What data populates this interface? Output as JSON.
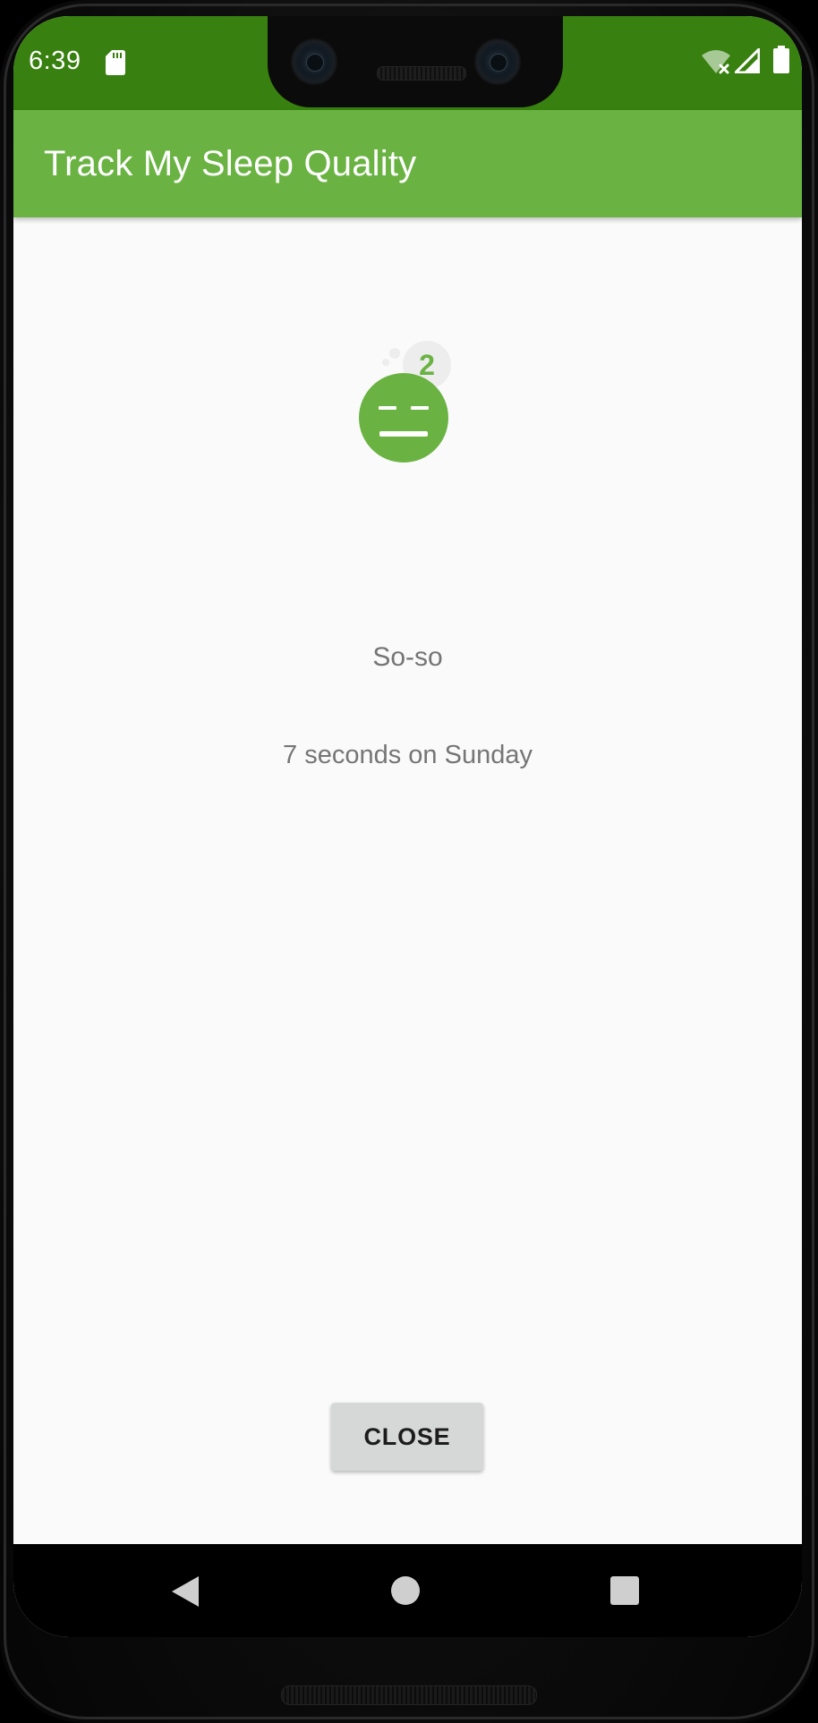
{
  "status_bar": {
    "time": "6:39",
    "icons": [
      "sd-card-icon",
      "wifi-off-icon",
      "signal-icon",
      "battery-icon"
    ]
  },
  "app_bar": {
    "title": "Track My Sleep Quality"
  },
  "sleep_detail": {
    "quality_icon": "sleep-quality-2-icon",
    "quality_number": "2",
    "quality_text": "So-so",
    "length_text": "7 seconds on Sunday"
  },
  "actions": {
    "close_label": "CLOSE"
  },
  "nav_bar": {
    "icons": [
      "back-icon",
      "home-icon",
      "recents-icon"
    ]
  },
  "colors": {
    "status_bar": "#38800f",
    "app_bar": "#6ab343",
    "accent_green": "#6ab343",
    "background": "#fafafa",
    "text_secondary": "#757575",
    "button": "#d6d7d7"
  }
}
